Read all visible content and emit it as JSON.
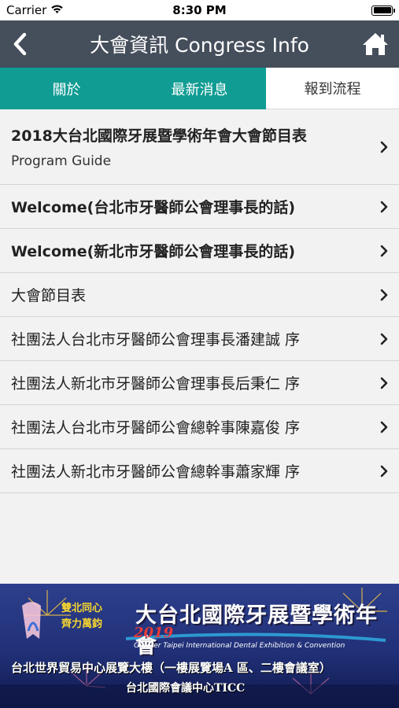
{
  "status_bar": {
    "carrier": "Carrier",
    "time": "8:30 PM",
    "battery_level": 1.0
  },
  "nav": {
    "title": "大會資訊 Congress Info",
    "back_icon": "chevron-left-icon",
    "home_icon": "home-icon"
  },
  "tabs": [
    {
      "label": "關於",
      "active": false
    },
    {
      "label": "最新消息",
      "active": false
    },
    {
      "label": "報到流程",
      "active": true
    }
  ],
  "items": [
    {
      "title": "2018大台北國際牙展暨學術年會大會節目表",
      "subtitle": "Program Guide"
    },
    {
      "title": "Welcome(台北市牙醫師公會理事長的話)"
    },
    {
      "title": "Welcome(新北市牙醫師公會理事長的話)"
    },
    {
      "title": "大會節目表"
    },
    {
      "title": "社團法人台北市牙醫師公會理事長潘建誠 序"
    },
    {
      "title": "社團法人新北市牙醫師公會理事長后秉仁 序"
    },
    {
      "title": "社團法人台北市牙醫師公會總幹事陳嘉俊 序"
    },
    {
      "title": "社團法人新北市牙醫師公會總幹事蕭家輝 序"
    }
  ],
  "banner": {
    "slogan_line1": "雙北同心",
    "slogan_line2": "齊力萬鈞",
    "title": "大台北國際牙展暨學術年會",
    "year": "2019",
    "subtitle_en": "Greater Taipei International Dental Exhibition & Convention",
    "venue_line1": "台北世界貿易中心展覽大樓（一樓展覽場A 區、二樓會議室）",
    "venue_line2": "台北國際會議中心TICC"
  },
  "colors": {
    "nav_bg": "#454e5b",
    "tab_bg": "#109c93",
    "list_bg": "#f2f2f2",
    "accent_red": "#e43b3b",
    "slogan_yellow": "#f7d72f"
  }
}
